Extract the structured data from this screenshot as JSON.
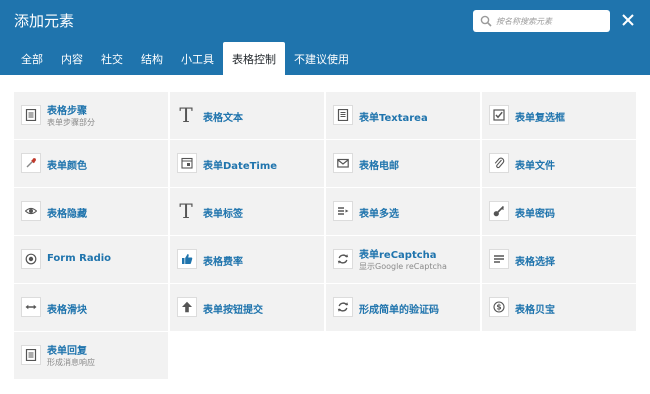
{
  "dialog": {
    "title": "添加元素",
    "search_placeholder": "按名称搜索元素",
    "close_icon": "close-icon"
  },
  "tabs": [
    {
      "label": "全部",
      "active": false
    },
    {
      "label": "内容",
      "active": false
    },
    {
      "label": "社交",
      "active": false
    },
    {
      "label": "结构",
      "active": false
    },
    {
      "label": "小工具",
      "active": false
    },
    {
      "label": "表格控制",
      "active": true
    },
    {
      "label": "不建议使用",
      "active": false
    }
  ],
  "elements": [
    {
      "label": "表格步骤",
      "desc": "表单步骤部分",
      "icon": "document-icon"
    },
    {
      "label": "表格文本",
      "desc": "",
      "icon": "text-t-icon"
    },
    {
      "label": "表单Textarea",
      "desc": "",
      "icon": "textarea-icon"
    },
    {
      "label": "表单复选框",
      "desc": "",
      "icon": "checkbox-icon"
    },
    {
      "label": "表单颜色",
      "desc": "",
      "icon": "eyedropper-icon"
    },
    {
      "label": "表单DateTime",
      "desc": "",
      "icon": "calendar-icon"
    },
    {
      "label": "表格电邮",
      "desc": "",
      "icon": "envelope-icon"
    },
    {
      "label": "表单文件",
      "desc": "",
      "icon": "paperclip-icon"
    },
    {
      "label": "表格隐藏",
      "desc": "",
      "icon": "eye-icon"
    },
    {
      "label": "表单标签",
      "desc": "",
      "icon": "text-t-icon"
    },
    {
      "label": "表单多选",
      "desc": "",
      "icon": "multiselect-icon"
    },
    {
      "label": "表单密码",
      "desc": "",
      "icon": "key-icon"
    },
    {
      "label": "Form Radio",
      "desc": "",
      "icon": "radio-icon"
    },
    {
      "label": "表格费率",
      "desc": "",
      "icon": "thumbs-up-icon"
    },
    {
      "label": "表单reCaptcha",
      "desc": "显示Google reCaptcha",
      "icon": "refresh-icon"
    },
    {
      "label": "表格选择",
      "desc": "",
      "icon": "select-list-icon"
    },
    {
      "label": "表格滑块",
      "desc": "",
      "icon": "slider-arrows-icon"
    },
    {
      "label": "表单按钮提交",
      "desc": "",
      "icon": "arrow-up-icon"
    },
    {
      "label": "形成简单的验证码",
      "desc": "",
      "icon": "refresh-icon"
    },
    {
      "label": "表格贝宝",
      "desc": "",
      "icon": "paypal-dollar-icon"
    },
    {
      "label": "表单回复",
      "desc": "形成消息响应",
      "icon": "document-icon"
    }
  ],
  "colors": {
    "header_bg": "#1f74ad",
    "accent": "#1f74ad",
    "item_bg": "#f2f2f2",
    "desc_text": "#8a8a8a"
  }
}
